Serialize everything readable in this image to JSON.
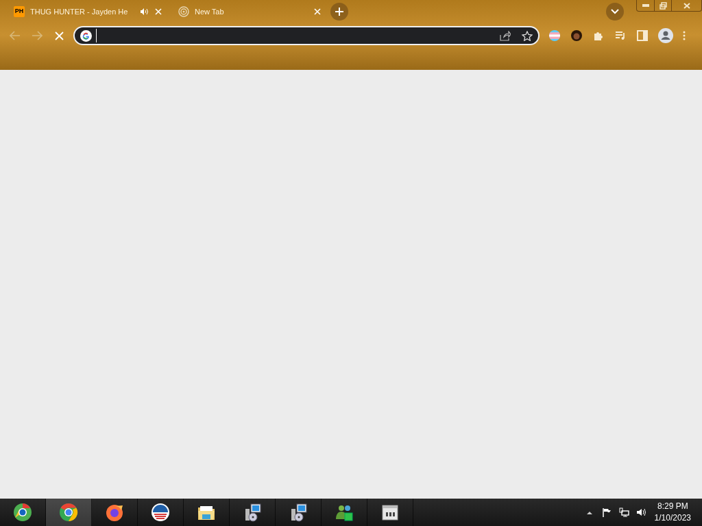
{
  "tabs": [
    {
      "title": "THUG HUNTER - Jayden He",
      "favicon": "PH",
      "audio": true
    },
    {
      "title": "New Tab",
      "audio": false
    }
  ],
  "taskbar": {
    "apps": [
      {
        "kind": "chromium",
        "active": false
      },
      {
        "kind": "chrome",
        "active": true
      },
      {
        "kind": "firefox",
        "active": false
      },
      {
        "kind": "logo",
        "active": false
      },
      {
        "kind": "folder",
        "active": false
      },
      {
        "kind": "installer",
        "active": false
      },
      {
        "kind": "installer",
        "active": false
      },
      {
        "kind": "messenger",
        "active": false
      },
      {
        "kind": "app",
        "active": false
      }
    ],
    "time": "8:29 PM",
    "date": "1/10/2023"
  }
}
